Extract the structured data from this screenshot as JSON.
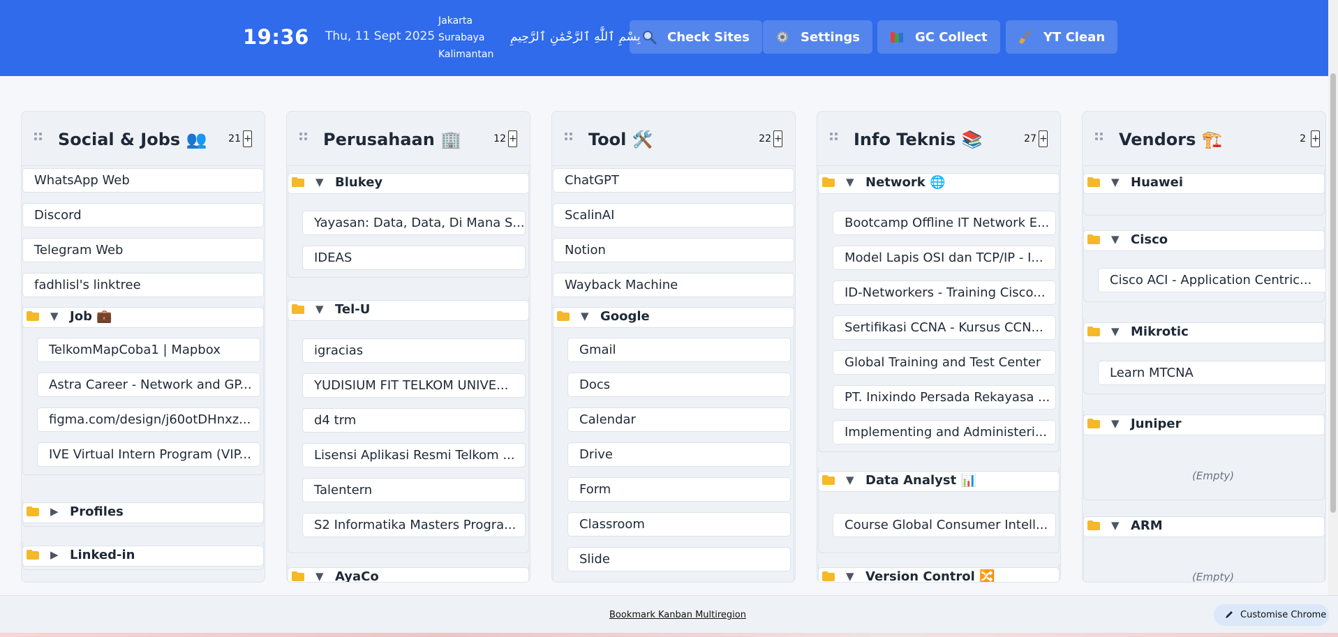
{
  "header": {
    "time": "19:36",
    "date": "Thu, 11 Sept 2025",
    "regions": [
      "Jakarta",
      "Surabaya",
      "Kalimantan"
    ],
    "bismillah": "بِسْمِ ٱللَّٰهِ ٱلرَّحْمَٰنِ ٱلرَّحِيمِ",
    "buttons": [
      {
        "label": "Check Sites",
        "icon": "magnifier-icon"
      },
      {
        "label": "Settings",
        "icon": "gear-icon"
      },
      {
        "label": "GC Collect",
        "icon": "books-icon"
      },
      {
        "label": "YT Clean",
        "icon": "broom-icon"
      }
    ]
  },
  "columns": [
    {
      "title": "Social & Jobs 👥",
      "count": "21",
      "add": "+",
      "items": [
        "WhatsApp Web",
        "Discord",
        "Telegram Web",
        "fadhlisl's linktree"
      ],
      "folders": [
        {
          "name": "Job 💼",
          "expanded": true,
          "items": [
            "TelkomMapCoba1 | Mapbox",
            "Astra Career - Network and GP...",
            "figma.com/design/j60otDHnxz...",
            "IVE Virtual Intern Program (VIP..."
          ]
        },
        {
          "name": "Profiles",
          "expanded": false,
          "items": []
        },
        {
          "name": "Linked-in",
          "expanded": false,
          "items": []
        }
      ]
    },
    {
      "title": "Perusahaan 🏢",
      "count": "12",
      "add": "+",
      "items": [],
      "folders": [
        {
          "name": "Blukey",
          "expanded": true,
          "items": [
            "Yayasan: Data, Data, Di Mana S...",
            "IDEAS"
          ]
        },
        {
          "name": "Tel-U",
          "expanded": true,
          "items": [
            "igracias",
            "YUDISIUM FIT TELKOM UNIVE...",
            "d4 trm",
            "Lisensi Aplikasi Resmi Telkom ...",
            "Talentern",
            "S2 Informatika Masters Progra..."
          ]
        },
        {
          "name": "AyaCo",
          "expanded": true,
          "items": []
        }
      ]
    },
    {
      "title": "Tool 🛠️",
      "count": "22",
      "add": "+",
      "items": [
        "ChatGPT",
        "ScalinAI",
        "Notion",
        "Wayback Machine"
      ],
      "folders": [
        {
          "name": "Google",
          "expanded": true,
          "items": [
            "Gmail",
            "Docs",
            "Calendar",
            "Drive",
            "Form",
            "Classroom",
            "Slide"
          ]
        }
      ]
    },
    {
      "title": "Info Teknis 📚",
      "count": "27",
      "add": "+",
      "items": [],
      "folders": [
        {
          "name": "Network 🌐",
          "expanded": true,
          "items": [
            "Bootcamp Offline IT Network E...",
            "Model Lapis OSI dan TCP/IP - I...",
            "ID-Networkers - Training Cisco...",
            "Sertifikasi CCNA - Kursus CCN...",
            "Global Training and Test Center",
            "PT. Inixindo Persada Rekayasa ...",
            "Implementing and Administeri..."
          ]
        },
        {
          "name": "Data Analyst 📊",
          "expanded": true,
          "items": [
            "Course Global Consumer Intell..."
          ]
        },
        {
          "name": "Version Control 🔀",
          "expanded": true,
          "items": []
        }
      ]
    },
    {
      "title": "Vendors 🏗️",
      "count": "2",
      "add": "+",
      "items": [],
      "folders": [
        {
          "name": "Huawei",
          "expanded": true,
          "items": []
        },
        {
          "name": "Cisco",
          "expanded": true,
          "items": [
            "Cisco ACI - Application Centric..."
          ]
        },
        {
          "name": "Mikrotic",
          "expanded": true,
          "items": [
            "Learn MTCNA"
          ]
        },
        {
          "name": "Juniper",
          "expanded": true,
          "items": [],
          "empty_label": "(Empty)"
        },
        {
          "name": "ARM",
          "expanded": true,
          "items": [],
          "empty_label": "(Empty)"
        }
      ]
    }
  ],
  "footer": {
    "link": "Bookmark Kanban Multiregion",
    "customise": "Customise Chrome"
  },
  "colors": {
    "header": "#2f6bea",
    "folder": "#f5b829",
    "panel": "#eef2f7"
  }
}
